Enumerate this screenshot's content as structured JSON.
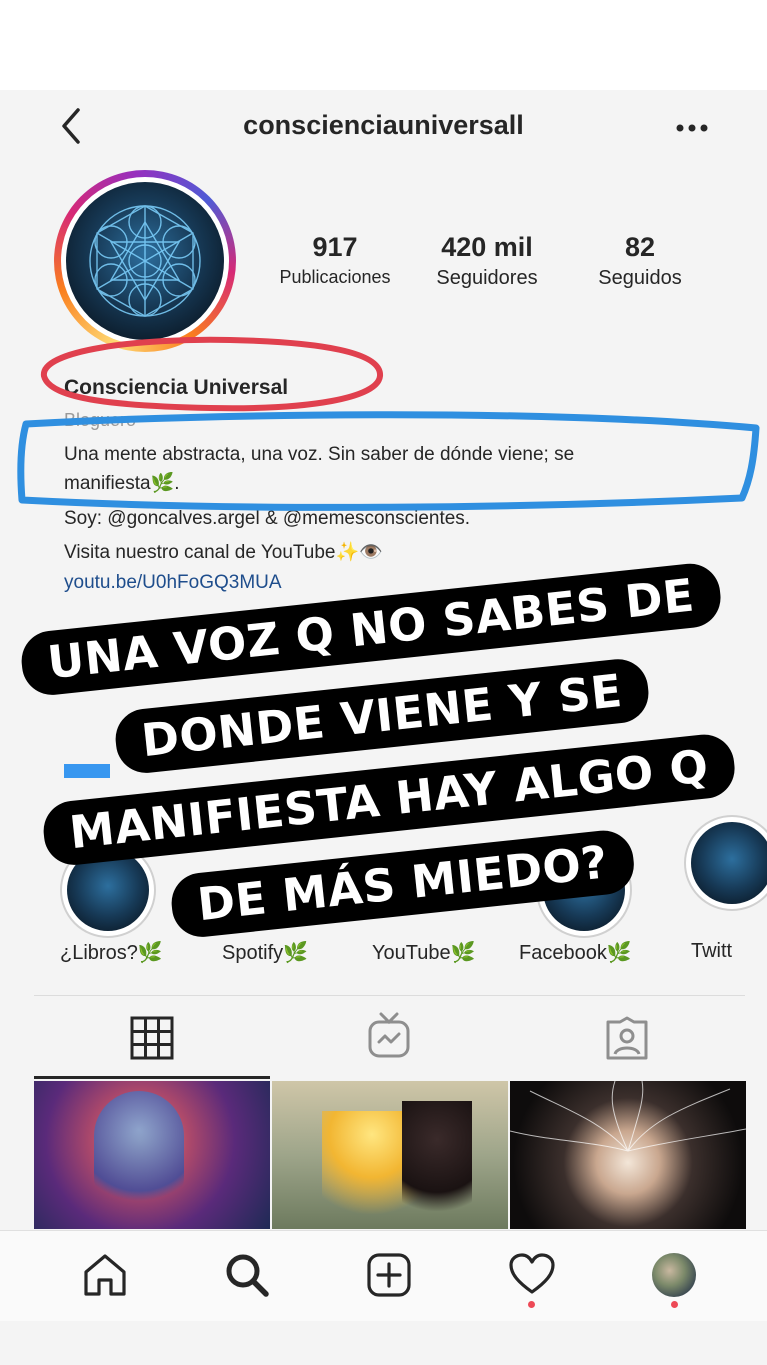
{
  "header": {
    "username": "conscienciauniversall"
  },
  "stats": [
    {
      "value": "917",
      "label": "Publicaciones"
    },
    {
      "value": "420 mil",
      "label": "Seguidores"
    },
    {
      "value": "82",
      "label": "Seguidos"
    }
  ],
  "profile": {
    "name": "Consciencia Universal",
    "category": "Bloguero",
    "bio_1": "Una mente abstracta, una voz. Sin saber de dónde viene; se",
    "bio_2": "manifiesta🌿.",
    "bio_3": "Soy: @goncalves.argel & @memesconscientes.",
    "bio_4": "Visita nuestro canal de YouTube✨👁️",
    "link": "youtu.be/U0hFoGQ3MUA"
  },
  "caption": {
    "line1": "UNA VOZ Q NO SABES DE",
    "line2": "DONDE VIENE Y SE",
    "line3": "MANIFIESTA HAY ALGO Q",
    "line4": "DE MÁS MIEDO?"
  },
  "highlights": [
    {
      "label": "¿Libros?🌿"
    },
    {
      "label": "Spotify🌿"
    },
    {
      "label": "YouTube🌿"
    },
    {
      "label": "Facebook🌿"
    },
    {
      "label": "Twitt"
    }
  ],
  "tabs": [
    "grid-icon",
    "igtv-icon",
    "tagged-icon"
  ],
  "nav": [
    "home-icon",
    "search-icon",
    "add-post-icon",
    "activity-icon",
    "profile-avatar"
  ],
  "colors": {
    "annotation_red": "#e0404e",
    "annotation_blue": "#2f8fe0",
    "link": "#1e4d8c",
    "notification_dot": "#ed4956"
  }
}
